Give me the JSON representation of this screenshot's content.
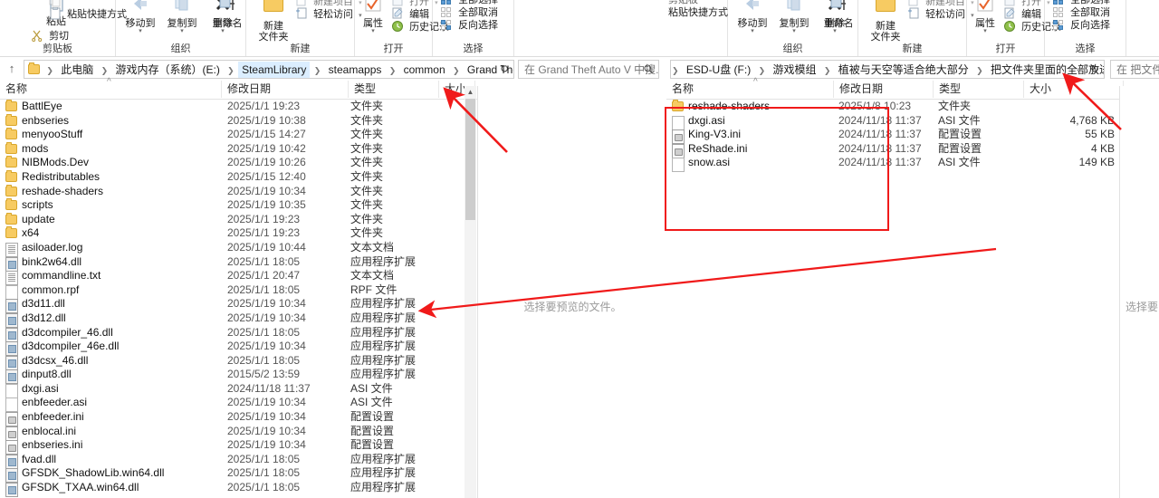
{
  "left_window": {
    "ribbon": {
      "groups": [
        {
          "label": "剪贴板",
          "buttons": [
            "粘贴",
            "剪切",
            "粘贴快捷方式"
          ]
        },
        {
          "label": "组织",
          "buttons": [
            "移动到",
            "复制到",
            "删除",
            "重命名"
          ]
        },
        {
          "label": "新建",
          "buttons": [
            "新建文件夹",
            "新建项目",
            "轻松访问"
          ]
        },
        {
          "label": "打开",
          "buttons": [
            "属性",
            "打开",
            "编辑",
            "历史记录"
          ]
        },
        {
          "label": "选择",
          "buttons": [
            "全部选择",
            "全部取消",
            "反向选择"
          ]
        }
      ],
      "paste_label": "粘贴",
      "cut_label": "剪切",
      "paste_shortcut_label": "粘贴快捷方式",
      "move_to_label": "移动到",
      "copy_to_label": "复制到",
      "delete_label": "删除",
      "rename_label": "重命名",
      "new_folder_label_1": "新建",
      "new_folder_label_2": "文件夹",
      "new_item_label": "新建项目",
      "easy_access_label": "轻松访问",
      "properties_label": "属性",
      "open_label": "打开",
      "edit_label": "编辑",
      "history_label": "历史记录",
      "select_all_label": "全部选择",
      "select_none_label": "全部取消",
      "invert_selection_label": "反向选择",
      "group_clipboard": "剪贴板",
      "group_organize": "组织",
      "group_new": "新建",
      "group_open": "打开",
      "group_select": "选择"
    },
    "address": {
      "up_icon": "↑",
      "breadcrumbs": [
        "此电脑",
        "游戏内存（系统）(E:)",
        "SteamLibrary",
        "steamapps",
        "common",
        "Grand Theft Auto V"
      ],
      "highlight_index": 2,
      "dropdown_caret": "⌄",
      "refresh_icon": "↻",
      "search_placeholder": "在 Grand Theft Auto V 中搜..."
    },
    "columns": [
      {
        "key": "name",
        "label": "名称"
      },
      {
        "key": "date",
        "label": "修改日期"
      },
      {
        "key": "type",
        "label": "类型"
      },
      {
        "key": "size",
        "label": "大小"
      }
    ],
    "sort_mark": "^",
    "files": [
      {
        "name": "BattlEye",
        "date": "2025/1/1 19:23",
        "type": "文件夹",
        "size": "",
        "icon": "folder"
      },
      {
        "name": "enbseries",
        "date": "2025/1/19 10:38",
        "type": "文件夹",
        "size": "",
        "icon": "folder"
      },
      {
        "name": "menyooStuff",
        "date": "2025/1/15 14:27",
        "type": "文件夹",
        "size": "",
        "icon": "folder"
      },
      {
        "name": "mods",
        "date": "2025/1/19 10:42",
        "type": "文件夹",
        "size": "",
        "icon": "folder"
      },
      {
        "name": "NIBMods.Dev",
        "date": "2025/1/19 10:26",
        "type": "文件夹",
        "size": "",
        "icon": "folder"
      },
      {
        "name": "Redistributables",
        "date": "2025/1/15 12:40",
        "type": "文件夹",
        "size": "",
        "icon": "folder"
      },
      {
        "name": "reshade-shaders",
        "date": "2025/1/19 10:34",
        "type": "文件夹",
        "size": "",
        "icon": "folder"
      },
      {
        "name": "scripts",
        "date": "2025/1/19 10:35",
        "type": "文件夹",
        "size": "",
        "icon": "folder"
      },
      {
        "name": "update",
        "date": "2025/1/1 19:23",
        "type": "文件夹",
        "size": "",
        "icon": "folder"
      },
      {
        "name": "x64",
        "date": "2025/1/1 19:23",
        "type": "文件夹",
        "size": "",
        "icon": "folder"
      },
      {
        "name": "asiloader.log",
        "date": "2025/1/19 10:44",
        "type": "文本文档",
        "size": "",
        "icon": "txt"
      },
      {
        "name": "bink2w64.dll",
        "date": "2025/1/1 18:05",
        "type": "应用程序扩展",
        "size": "",
        "icon": "dll"
      },
      {
        "name": "commandline.txt",
        "date": "2025/1/1 20:47",
        "type": "文本文档",
        "size": "",
        "icon": "txt"
      },
      {
        "name": "common.rpf",
        "date": "2025/1/1 18:05",
        "type": "RPF 文件",
        "size": "",
        "icon": "blank"
      },
      {
        "name": "d3d11.dll",
        "date": "2025/1/19 10:34",
        "type": "应用程序扩展",
        "size": "",
        "icon": "dll"
      },
      {
        "name": "d3d12.dll",
        "date": "2025/1/19 10:34",
        "type": "应用程序扩展",
        "size": "",
        "icon": "dll"
      },
      {
        "name": "d3dcompiler_46.dll",
        "date": "2025/1/1 18:05",
        "type": "应用程序扩展",
        "size": "",
        "icon": "dll"
      },
      {
        "name": "d3dcompiler_46e.dll",
        "date": "2025/1/19 10:34",
        "type": "应用程序扩展",
        "size": "",
        "icon": "dll"
      },
      {
        "name": "d3dcsx_46.dll",
        "date": "2025/1/1 18:05",
        "type": "应用程序扩展",
        "size": "",
        "icon": "dll"
      },
      {
        "name": "dinput8.dll",
        "date": "2015/5/2 13:59",
        "type": "应用程序扩展",
        "size": "",
        "icon": "dll"
      },
      {
        "name": "dxgi.asi",
        "date": "2024/11/18 11:37",
        "type": "ASI 文件",
        "size": "",
        "icon": "blank"
      },
      {
        "name": "enbfeeder.asi",
        "date": "2025/1/19 10:34",
        "type": "ASI 文件",
        "size": "",
        "icon": "blank"
      },
      {
        "name": "enbfeeder.ini",
        "date": "2025/1/19 10:34",
        "type": "配置设置",
        "size": "",
        "icon": "ini"
      },
      {
        "name": "enblocal.ini",
        "date": "2025/1/19 10:34",
        "type": "配置设置",
        "size": "",
        "icon": "ini"
      },
      {
        "name": "enbseries.ini",
        "date": "2025/1/19 10:34",
        "type": "配置设置",
        "size": "",
        "icon": "ini"
      },
      {
        "name": "fvad.dll",
        "date": "2025/1/1 18:05",
        "type": "应用程序扩展",
        "size": "",
        "icon": "dll"
      },
      {
        "name": "GFSDK_ShadowLib.win64.dll",
        "date": "2025/1/1 18:05",
        "type": "应用程序扩展",
        "size": "",
        "icon": "dll"
      },
      {
        "name": "GFSDK_TXAA.win64.dll",
        "date": "2025/1/1 18:05",
        "type": "应用程序扩展",
        "size": "",
        "icon": "dll"
      }
    ],
    "preview_message": "选择要预览的文件。"
  },
  "right_window": {
    "ribbon": {
      "paste_shortcut_label": "粘贴快捷方式",
      "clipboard_partial_label": "剪贴板",
      "move_to_label": "移动到",
      "copy_to_label": "复制到",
      "delete_label": "删除",
      "rename_label": "重命名",
      "new_folder_label_1": "新建",
      "new_folder_label_2": "文件夹",
      "new_item_label": "新建项目",
      "easy_access_label": "轻松访问",
      "properties_label": "属性",
      "open_label": "打开",
      "edit_label": "编辑",
      "history_label": "历史记录",
      "select_all_label": "全部选择",
      "select_none_label": "全部取消",
      "invert_selection_label": "反向选择",
      "group_organize": "组织",
      "group_new": "新建",
      "group_open": "打开",
      "group_select": "选择"
    },
    "address": {
      "breadcrumbs": [
        "ESD-U盘 (F:)",
        "游戏模组",
        "植被与天空等适合绝大部分",
        "把文件夹里面的全部放进根目录（必装）"
      ],
      "dropdown_caret": "⌄",
      "refresh_icon": "↻",
      "search_placeholder": "在 把文件"
    },
    "columns": [
      {
        "key": "name",
        "label": "名称"
      },
      {
        "key": "date",
        "label": "修改日期"
      },
      {
        "key": "type",
        "label": "类型"
      },
      {
        "key": "size",
        "label": "大小"
      }
    ],
    "sort_mark": "^",
    "files": [
      {
        "name": "reshade-shaders",
        "date": "2025/1/8 10:23",
        "type": "文件夹",
        "size": "",
        "icon": "folder"
      },
      {
        "name": "dxgi.asi",
        "date": "2024/11/18 11:37",
        "type": "ASI 文件",
        "size": "4,768 KB",
        "icon": "blank"
      },
      {
        "name": "King-V3.ini",
        "date": "2024/11/18 11:37",
        "type": "配置设置",
        "size": "55 KB",
        "icon": "ini"
      },
      {
        "name": "ReShade.ini",
        "date": "2024/11/18 11:37",
        "type": "配置设置",
        "size": "4 KB",
        "icon": "ini"
      },
      {
        "name": "snow.asi",
        "date": "2024/11/18 11:37",
        "type": "ASI 文件",
        "size": "149 KB",
        "icon": "blank"
      }
    ],
    "preview_message": "选择要"
  },
  "annotations": {
    "accent_color": "#f01a1a",
    "arrow_count": 3,
    "highlight_box": "selected-files-box"
  }
}
